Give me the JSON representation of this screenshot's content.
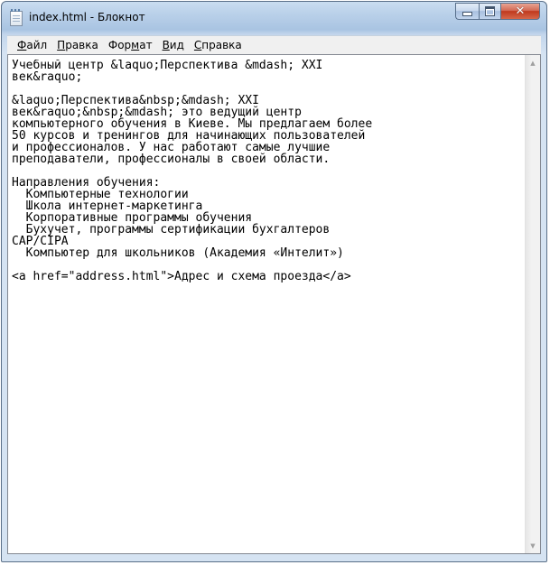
{
  "window": {
    "title": "index.html - Блокнот"
  },
  "menu": {
    "items": [
      {
        "prefix": "",
        "underline": "Ф",
        "rest": "айл"
      },
      {
        "prefix": "",
        "underline": "П",
        "rest": "равка"
      },
      {
        "prefix": "Фор",
        "underline": "м",
        "rest": "ат"
      },
      {
        "prefix": "",
        "underline": "В",
        "rest": "ид"
      },
      {
        "prefix": "",
        "underline": "С",
        "rest": "правка"
      }
    ]
  },
  "editor": {
    "text": "Учебный центр &laquo;Перспектива &mdash; XXI\nвек&raquo;\n\n&laquo;Перспектива&nbsp;&mdash; XXI\nвек&raquo;&nbsp;&mdash; это ведущий центр\nкомпьютерного обучения в Киеве. Мы предлагаем более\n50 курсов и тренингов для начинающих пользователей\nи профессионалов. У нас работают самые лучшие\nпреподаватели, профессионалы в своей области.\n\nНаправления обучения:\n  Компьютерные технологии\n  Школа интернет-маркетинга\n  Корпоративные программы обучения\n  Бухучет, программы сертификации бухгалтеров\nCAP/CIPA\n  Компьютер для школьников (Академия «Интелит»)\n\n<a href=\"address.html\">Адрес и схема проезда</a>"
  },
  "icons": {
    "app": "notepad-icon",
    "minimize": "minimize-icon",
    "maximize": "maximize-icon",
    "close": "close-icon",
    "scroll_up": "scroll-up-arrow-icon",
    "scroll_down": "scroll-down-arrow-icon"
  },
  "colors": {
    "close_button": "#c7432a",
    "frame": "#b9d0e9"
  }
}
